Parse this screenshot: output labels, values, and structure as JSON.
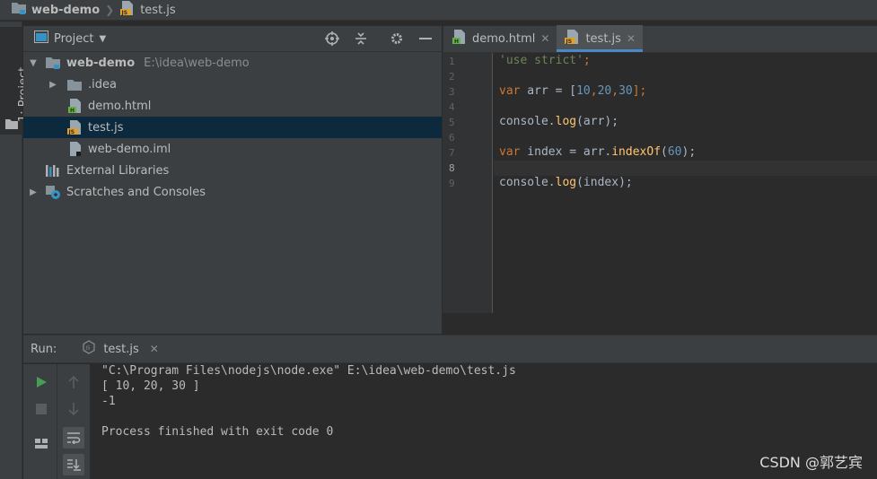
{
  "navbar": {
    "project": "web-demo",
    "file": "test.js"
  },
  "stripe": {
    "project_tab": "1: Project"
  },
  "project_pane": {
    "title": "Project",
    "tree": [
      {
        "label": "web-demo",
        "hint": "E:\\idea\\web-demo",
        "expanded": true,
        "icon": "module-folder-icon"
      },
      {
        "label": ".idea",
        "expanded": false,
        "icon": "folder-icon"
      },
      {
        "label": "demo.html",
        "icon": "html-file-icon"
      },
      {
        "label": "test.js",
        "icon": "js-file-icon",
        "selected": true
      },
      {
        "label": "web-demo.iml",
        "icon": "iml-file-icon"
      },
      {
        "label": "External Libraries",
        "icon": "libraries-icon"
      },
      {
        "label": "Scratches and Consoles",
        "expanded": false,
        "icon": "scratches-icon"
      }
    ]
  },
  "editor": {
    "tabs": [
      {
        "label": "demo.html",
        "active": false
      },
      {
        "label": "test.js",
        "active": true
      }
    ],
    "line_numbers": [
      "1",
      "2",
      "3",
      "4",
      "5",
      "6",
      "7",
      "8",
      "9"
    ],
    "current_line": "8",
    "code": {
      "l1_str": "'use strict'",
      "l1_semi": ";",
      "l3_kw": "var",
      "l3_a": " arr = [",
      "l3_n1": "10",
      "l3_c1": ",",
      "l3_n2": "20",
      "l3_c2": ",",
      "l3_n3": "30",
      "l3_end": "];",
      "l5_a": "console.",
      "l5_fn": "log",
      "l5_b": "(arr);",
      "l7_kw": "var",
      "l7_a": " index = arr.",
      "l7_fn": "indexOf",
      "l7_p": "(",
      "l7_n": "60",
      "l7_end": ");",
      "l9_a": "console.",
      "l9_fn": "log",
      "l9_b": "(index);"
    }
  },
  "run": {
    "label": "Run:",
    "tab": "test.js",
    "console": [
      "\"C:\\Program Files\\nodejs\\node.exe\" E:\\idea\\web-demo\\test.js",
      "[ 10, 20, 30 ]",
      "-1",
      "",
      "Process finished with exit code 0"
    ]
  },
  "watermark": "CSDN @郭艺宾",
  "colors": {
    "accent": "#4a88c7",
    "selection": "#0d293e",
    "run_green": "#499c54"
  }
}
